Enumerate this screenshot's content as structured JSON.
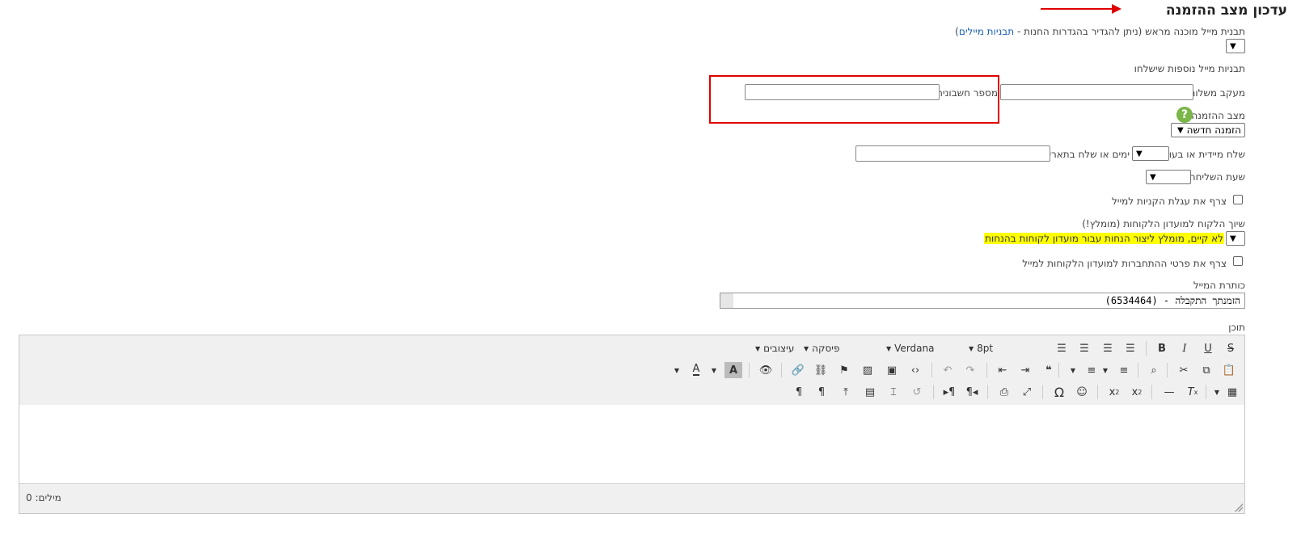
{
  "page": {
    "title": "עדכון מצב ההזמנה",
    "preset_template_label": "תבנית מייל מוכנה מראש (ניתן להגדיר בהגדרות החנות -",
    "preset_template_link": "תבניות מיילים",
    "preset_template_close": ")",
    "additional_templates_label": "תבניות מייל נוספות שישלחו",
    "tracking_label": "מעקב משלוח",
    "invoice_label": "מספר חשבונית",
    "order_status_label": "מצב ההזמנה",
    "order_status_value": "הזמנה חדשה",
    "help_glyph": "?",
    "send_label_a": "שלח מיידית או בעוד",
    "send_label_b": "ימים או שלח בתאריך",
    "send_time_label": "שעת השליחה",
    "attach_cart_label": "צרף את עגלת הקניות למייל",
    "club_label": "שיוך הלקוח למועדון הלקוחות (מומלץ!)",
    "club_value": "לא קיים, מומלץ ליצור הנחות עבור מועדון לקוחות בהנחות",
    "attach_club_label": "צרף את פרטי ההתחברות למועדון הלקוחות למייל",
    "subject_label": "כותרת המייל",
    "subject_value": "הזמנתך התקבלה - (6534464)",
    "content_label": "תוכן"
  },
  "editor": {
    "font_size": "8pt",
    "font_family": "Verdana",
    "paragraph": "פיסקה",
    "styles": "עיצובים",
    "word_count": "מילים: 0"
  },
  "colors": {
    "accent_red": "#e00000",
    "link_blue": "#1a5fb4",
    "highlight_yellow": "#ffff00",
    "help_green": "#7ab648"
  }
}
